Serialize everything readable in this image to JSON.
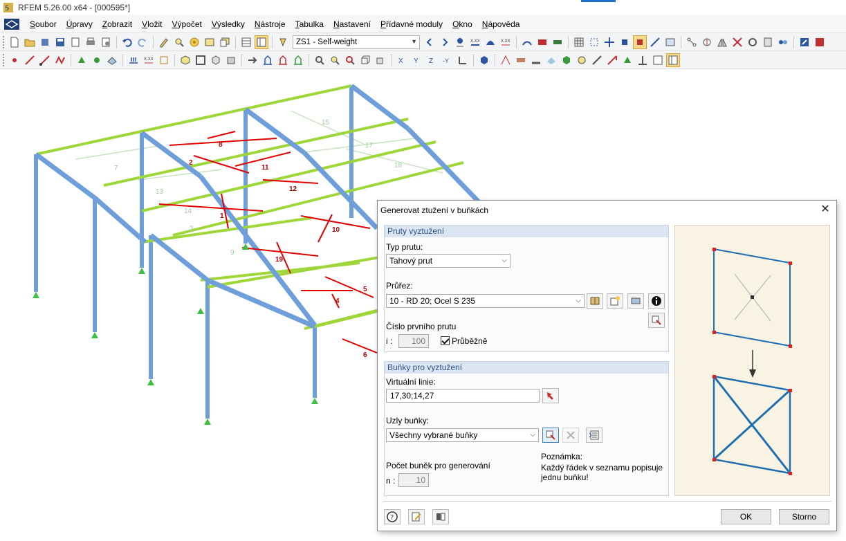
{
  "window": {
    "title": "RFEM 5.26.00 x64 - [000595*]"
  },
  "menu": [
    "Soubor",
    "Úpravy",
    "Zobrazit",
    "Vložit",
    "Výpočet",
    "Výsledky",
    "Nástroje",
    "Tabulka",
    "Nastavení",
    "Přídavné moduly",
    "Okno",
    "Nápověda"
  ],
  "toolbar": {
    "load_case": "ZS1 - Self-weight"
  },
  "model": {
    "labels": [
      "15",
      "8",
      "2",
      "17",
      "11",
      "7",
      "18",
      "12",
      "13",
      "1",
      "14",
      "10",
      "3",
      "9",
      "19",
      "5",
      "4",
      "6"
    ]
  },
  "dialog": {
    "title": "Generovat ztužení v buňkách",
    "section_members": "Pruty vyztužení",
    "member_type_label": "Typ prutu:",
    "member_type_value": "Tahový prut",
    "section_label": "Průřez:",
    "section_value": "10 - RD 20; Ocel S 235",
    "first_member_label": "Číslo prvního prutu",
    "i_label": "i :",
    "first_member_value": "100",
    "continuous_label": "Průběžně",
    "section_cells": "Buňky pro vyztužení",
    "virtual_lines_label": "Virtuální linie:",
    "virtual_lines_value": "17,30;14,27",
    "cell_nodes_label": "Uzly buňky:",
    "cell_nodes_value": "Všechny vybrané buňky",
    "cell_count_label": "Počet buněk pro generování",
    "n_label": "n :",
    "cell_count_value": "10",
    "note_title": "Poznámka:",
    "note_text_1": "Každý řádek v seznamu popisuje",
    "note_text_2": "jednu buňku!",
    "ok": "OK",
    "cancel": "Storno"
  },
  "colors": {
    "column": "#6f9fdb",
    "purlin": "#9fd63a",
    "bracing": "#e00000",
    "dialog_group": "#dce6f3",
    "preview_bg": "#f8f3e3"
  }
}
